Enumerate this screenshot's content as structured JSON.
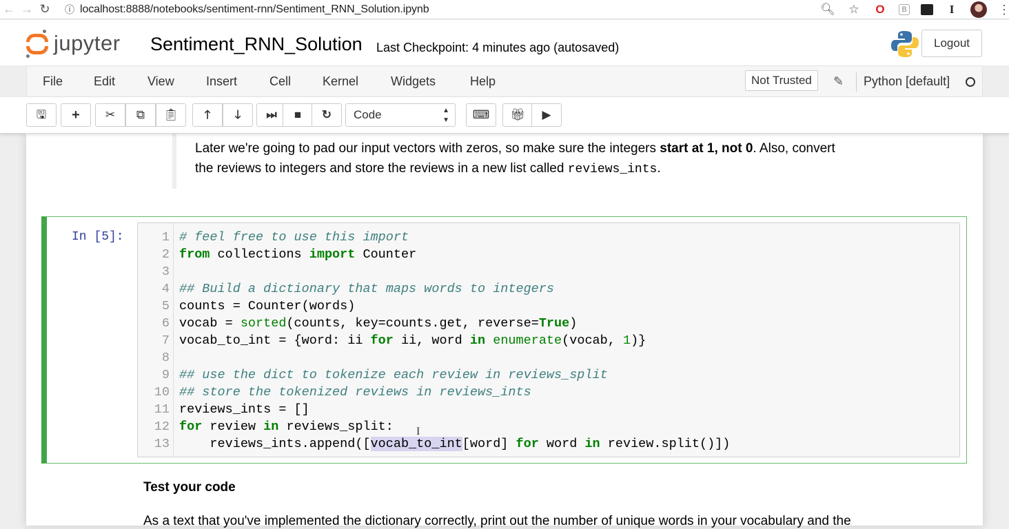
{
  "browser": {
    "url": "localhost:8888/notebooks/sentiment-rnn/Sentiment_RNN_Solution.ipynb"
  },
  "header": {
    "logo_text": "jupyter",
    "notebook_name": "Sentiment_RNN_Solution",
    "checkpoint": "Last Checkpoint: 4 minutes ago (autosaved)",
    "logout_label": "Logout"
  },
  "menubar": {
    "items": [
      "File",
      "Edit",
      "View",
      "Insert",
      "Cell",
      "Kernel",
      "Widgets",
      "Help"
    ],
    "trust_label": "Not Trusted",
    "kernel_name": "Python [default]"
  },
  "toolbar": {
    "cell_type": "Code"
  },
  "markdown": {
    "line1_pre": "Later we're going to pad our input vectors with zeros, so make sure the integers ",
    "line1_bold": "start at 1, not 0",
    "line1_post": ". Also, convert",
    "line2_pre": "the reviews to integers and store the reviews in a new list called ",
    "line2_code": "reviews_ints",
    "line2_post": "."
  },
  "code_cell": {
    "prompt": "In [5]:",
    "line_numbers": [
      "1",
      "2",
      "3",
      "4",
      "5",
      "6",
      "7",
      "8",
      "9",
      "10",
      "11",
      "12",
      "13"
    ],
    "l1": "# feel free to use this import",
    "l2_kw1": "from",
    "l2_mid": " collections ",
    "l2_kw2": "import",
    "l2_end": " Counter",
    "l4": "## Build a dictionary that maps words to integers",
    "l5": "counts = Counter(words)",
    "l6_a": "vocab = ",
    "l6_fn": "sorted",
    "l6_b": "(counts, key=counts.get, reverse=",
    "l6_kw": "True",
    "l6_c": ")",
    "l7_a": "vocab_to_int = {word: ii ",
    "l7_kw1": "for",
    "l7_b": " ii, word ",
    "l7_kw2": "in",
    "l7_sp": " ",
    "l7_fn": "enumerate",
    "l7_c": "(vocab, ",
    "l7_num": "1",
    "l7_d": ")}",
    "l9": "## use the dict to tokenize each review in reviews_split",
    "l10": "## store the tokenized reviews in reviews_ints",
    "l11": "reviews_ints = []",
    "l12_kw1": "for",
    "l12_a": " review ",
    "l12_kw2": "in",
    "l12_b": " reviews_split:",
    "l13_a": "    reviews_ints.append([",
    "l13_sel": "vocab_to_int",
    "l13_b": "[word] ",
    "l13_kw1": "for",
    "l13_c": " word ",
    "l13_kw2": "in",
    "l13_d": " review.split()])"
  },
  "test_section": {
    "heading": "Test your code",
    "text": "As a text that you've implemented the dictionary correctly, print out the number of unique words in your vocabulary and the"
  }
}
